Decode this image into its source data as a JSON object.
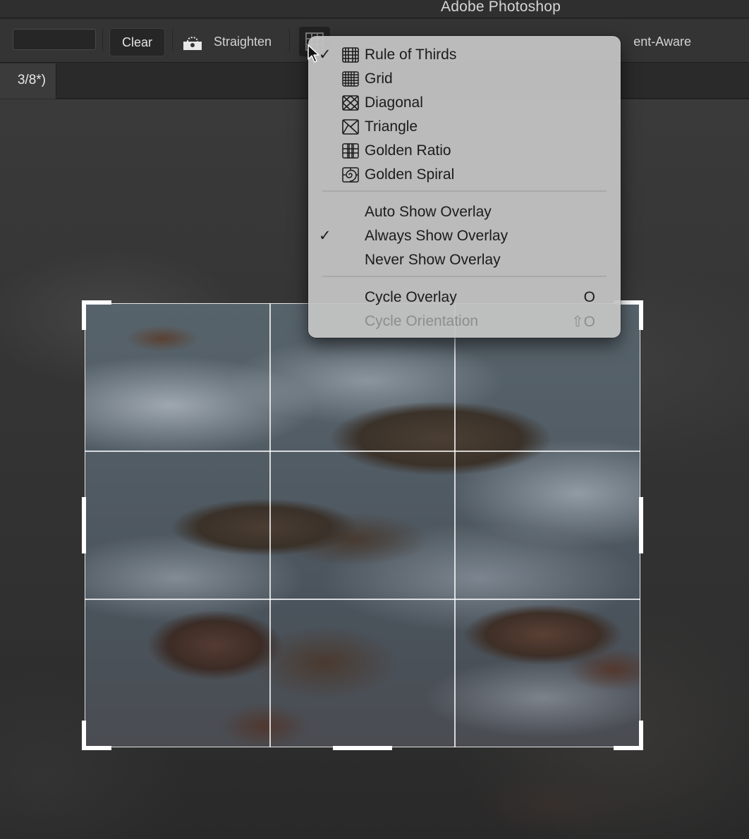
{
  "window": {
    "title": "Adobe Photoshop"
  },
  "options_bar": {
    "clear_label": "Clear",
    "straighten_label": "Straighten",
    "content_aware_label": "ent-Aware",
    "icons": {
      "straighten": "straighten-level-icon",
      "overlay": "crop-overlay-grid-icon"
    }
  },
  "document": {
    "tab_label": "3/8*)"
  },
  "overlay_menu": {
    "overlay_items": [
      {
        "label": "Rule of Thirds",
        "icon": "rule-of-thirds-icon",
        "checked": true
      },
      {
        "label": "Grid",
        "icon": "grid-icon",
        "checked": false
      },
      {
        "label": "Diagonal",
        "icon": "diagonal-icon",
        "checked": false
      },
      {
        "label": "Triangle",
        "icon": "triangle-icon",
        "checked": false
      },
      {
        "label": "Golden Ratio",
        "icon": "golden-ratio-icon",
        "checked": false
      },
      {
        "label": "Golden Spiral",
        "icon": "golden-spiral-icon",
        "checked": false
      }
    ],
    "show_items": [
      {
        "label": "Auto Show Overlay",
        "checked": false
      },
      {
        "label": "Always Show Overlay",
        "checked": true
      },
      {
        "label": "Never Show Overlay",
        "checked": false
      }
    ],
    "cycle_items": [
      {
        "label": "Cycle Overlay",
        "shortcut": "O",
        "enabled": true
      },
      {
        "label": "Cycle Orientation",
        "shortcut": "⇧O",
        "enabled": false
      }
    ],
    "check_glyph": "✓"
  },
  "colors": {
    "menu_background": "#c4c4c4",
    "menu_text": "#1b1b1b",
    "menu_disabled_text": "#8d8d8d",
    "toolbar_background": "#343434",
    "crop_guides": "#ffffff"
  }
}
